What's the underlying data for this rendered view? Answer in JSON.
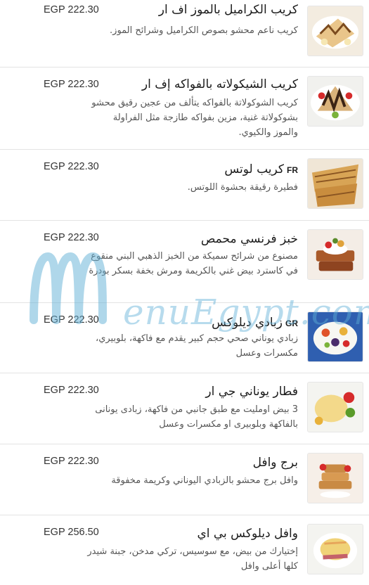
{
  "items": [
    {
      "title": "كريب الكراميل بالموز اف ار",
      "prefix": "",
      "price": "EGP 222.30",
      "desc": "كريب ناعم محشو بصوص الكراميل وشرائح الموز.",
      "icon": "crepe-banana-caramel-photo"
    },
    {
      "title": "كريب الشيكولاته بالفواكه إف ار",
      "prefix": "",
      "price": "EGP 222.30",
      "desc": "كريب الشوكولاتة بالفواكه يتألف من عجين رقيق محشو بشوكولاتة غنية، مزين بفواكه طازجة مثل الفراولة والموز والكيوي.",
      "icon": "chocolate-fruit-crepe-photo"
    },
    {
      "title": "كريب لوتس",
      "prefix": "FR",
      "price": "EGP 222.30",
      "desc": "فطيرة رقيقة بحشوة اللوتس.",
      "icon": "lotus-crepe-photo"
    },
    {
      "title": "خبز فرنسي محمص",
      "prefix": "",
      "price": "EGP 222.30",
      "desc": "مصنوع من شرائح سميكة من الخبز الذهبي البني منقوع في كاسترد بيض غني بالكريمة ومرش بخفة بسكر بودرة",
      "icon": "french-toast-photo"
    },
    {
      "title": "زبادي ديلوكس",
      "prefix": "GR",
      "price": "EGP 222.30",
      "desc": "زبادي يوناني صحي حجم كبير يقدم مع فاكهة، بلوبيري، مكسرات وعسل",
      "icon": "greek-yogurt-bowl-photo"
    },
    {
      "title": "فطار يوناني جي ار",
      "prefix": "",
      "price": "EGP 222.30",
      "desc": "3 بيض اومليت مع طبق جانبي من فاكهة، زبادى يونانى بالفاكهة وبلوبيرى او مكسرات وعسل",
      "icon": "greek-breakfast-photo"
    },
    {
      "title": "برج وافل",
      "prefix": "",
      "price": "EGP 222.30",
      "desc": "وافل برج محشو بالزبادي اليوناني وكريمة مخفوقة",
      "icon": "waffle-tower-photo"
    },
    {
      "title": "وافل ديلوكس بي اي",
      "prefix": "",
      "price": "EGP 256.50",
      "desc": "إختيارك من بيض، مع سوسيس، تركي مدخن، جبنة شيدر كلها أعلى وافل",
      "icon": "deluxe-waffle-photo"
    }
  ],
  "watermark": {
    "text": "enuEgypt.com",
    "icon": "menu-egypt-logo-m"
  },
  "colors": {
    "text": "#1c1c1c",
    "muted": "#555555",
    "divider": "#e3e3e3",
    "watermark": "#60b0d6"
  }
}
